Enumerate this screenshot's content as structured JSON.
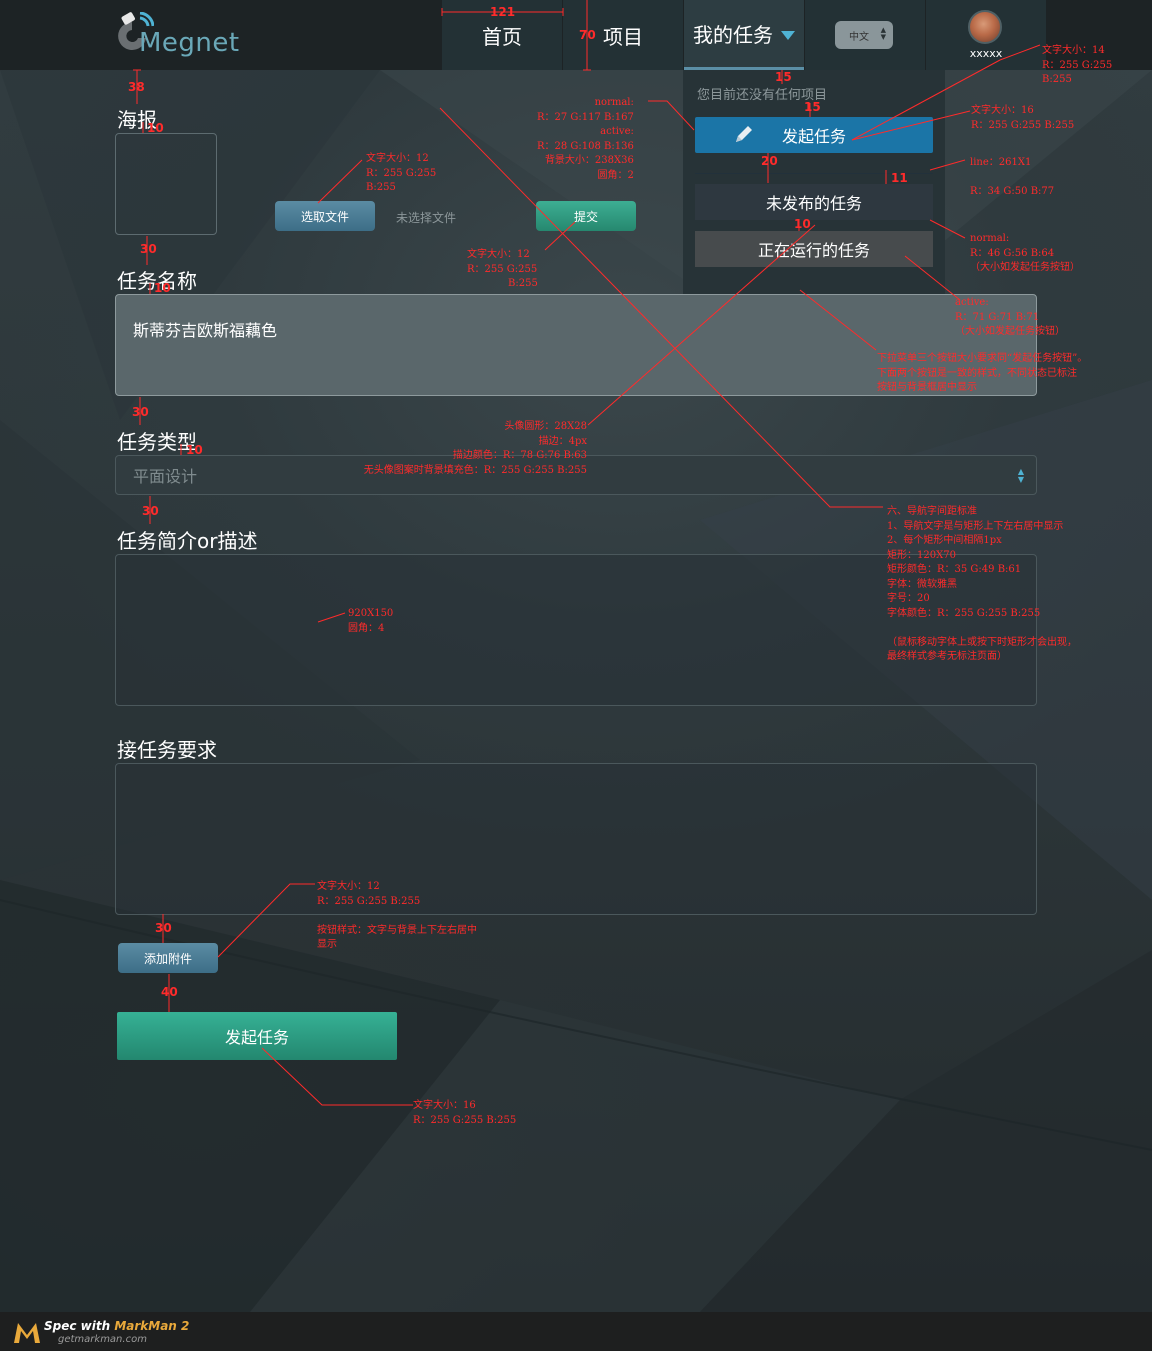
{
  "nav": {
    "logo_text": "Megnet",
    "items": [
      {
        "label": "首页"
      },
      {
        "label": "项目"
      },
      {
        "label": "我的任务"
      }
    ],
    "language": "中文",
    "username": "xxxxx"
  },
  "dropdown": {
    "empty_text": "您目前还没有任何项目",
    "start_button": "发起任务",
    "unpublished_button": "未发布的任务",
    "running_button": "正在运行的任务"
  },
  "form": {
    "poster_label": "海报",
    "choose_file_button": "选取文件",
    "no_file_text": "未选择文件",
    "submit_button": "提交",
    "name_label": "任务名称",
    "name_value": "斯蒂芬吉欧斯福藕色",
    "type_label": "任务类型",
    "type_placeholder": "平面设计",
    "desc_label": "任务简介or描述",
    "req_label": "接任务要求",
    "attach_button": "添加附件",
    "launch_button": "发起任务"
  },
  "annotations": {
    "dims": {
      "d121": "121",
      "d70": "70",
      "d15a": "15",
      "d15b": "15",
      "d20": "20",
      "d11": "11",
      "d10dd": "10",
      "d38": "38",
      "d10a": "10",
      "d30a": "30",
      "d10b": "10",
      "d30b": "30",
      "d10c": "10",
      "d30c": "30",
      "d30d": "30",
      "d40": "40"
    },
    "user_text": [
      "文字大小：14",
      "R：255 G:255",
      "B:255"
    ],
    "btn_states": [
      "normal:",
      "R：27 G:117 B:167",
      "active:",
      "R：28 G:108 B:136",
      "背景大小：238X36",
      "圆角：2"
    ],
    "start_text": [
      "文字大小：16",
      "R：255 G:255 B:255"
    ],
    "line_note": [
      "line：261X1",
      "",
      "R：34 G:50 B:77"
    ],
    "normal_note": [
      "normal:",
      "R：46 G:56 B:64",
      "（大小如发起任务按钮）"
    ],
    "active_note": [
      "active:",
      "R：71 G:71 B:71",
      "（大小如发起任务按钮）"
    ],
    "dropdown_note": [
      "下拉菜单三个按钮大小要求同“发起任务按钮”。",
      "下面两个按钮是一致的样式，不同状态已标注",
      "按钮与背景框居中显示"
    ],
    "file_text_note": [
      "文字大小：12",
      "R：255 G:255",
      "B:255"
    ],
    "submit_text_note": [
      "文字大小：12",
      "R：255 G:255",
      "B:255"
    ],
    "avatar_note": [
      "头像圆形：28X28",
      "描边：4px",
      "描边颜色：R：78 G:76 B:63",
      "无头像图案时背景填充色：R：255 G:255 B:255"
    ],
    "nav_note": [
      "六、导航字间距标准",
      "1、导航文字是与矩形上下左右居中显示",
      "2、每个矩形中间相隔1px",
      "矩形：120X70",
      "矩形颜色：R：35 G:49 B:61",
      "字体：微软雅黑",
      "字号：20",
      "字体颜色：R：255 G:255 B:255",
      "",
      "（鼠标移动字体上或按下时矩形才会出现，",
      "最终样式参考无标注页面）"
    ],
    "textarea_note": [
      "920X150",
      "圆角：4"
    ],
    "attach_note": [
      "文字大小：12",
      "R：255 G:255 B:255",
      "",
      "按钮样式：文字与背景上下左右居中",
      "显示"
    ],
    "launch_note": [
      "文字大小：16",
      "R：255 G:255 B:255"
    ]
  },
  "footer": {
    "spec_prefix": "Spec with ",
    "brand": "MarkMan 2",
    "url": "getmarkman.com"
  },
  "colors": {
    "nav_bg": "#1d2325",
    "nav_item": "#233135",
    "start_button": "#1b75a7",
    "dd_normal": "#2e3840",
    "dd_active": "#474b4d",
    "submit": "#2a9a80",
    "file_button": "#4a7d96",
    "annotation": "#ff2b2b"
  }
}
